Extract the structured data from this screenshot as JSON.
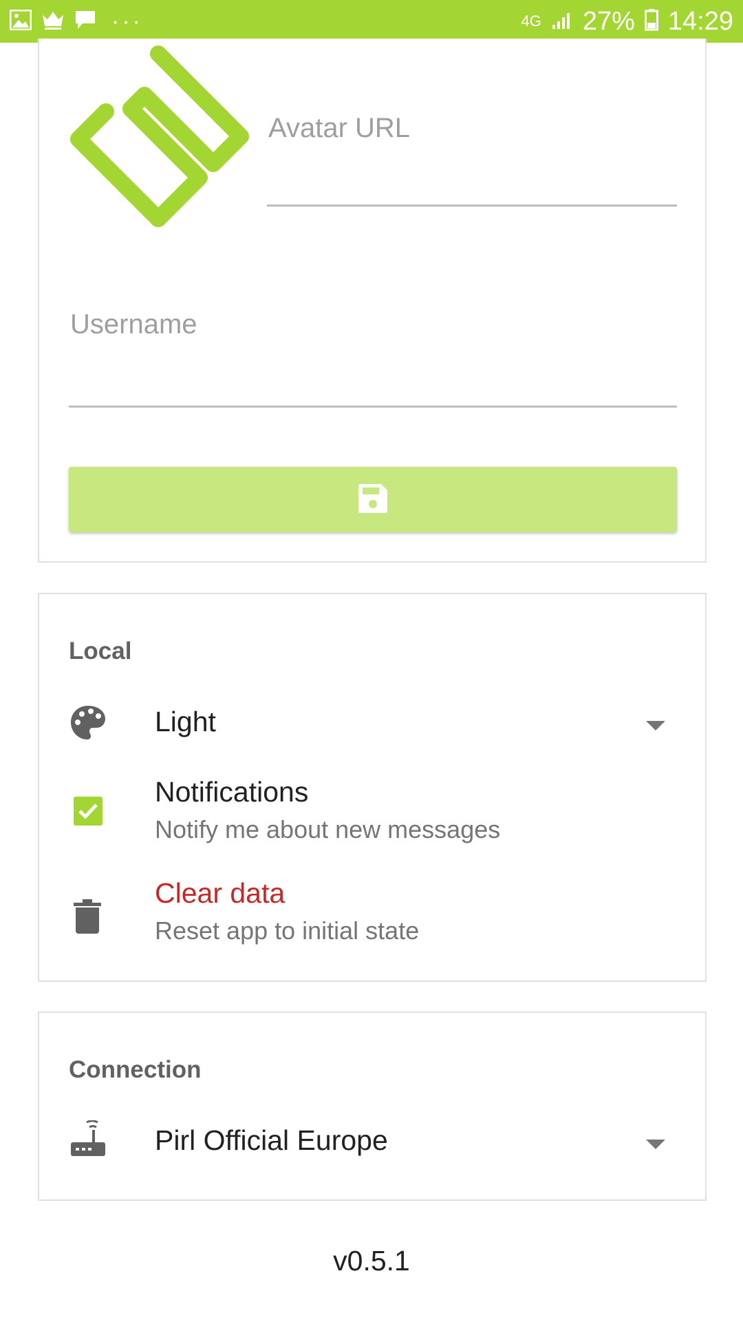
{
  "status_bar": {
    "network": "4G",
    "battery": "27%",
    "time": "14:29",
    "dots": "···"
  },
  "profile": {
    "avatar_label": "Avatar URL",
    "username_label": "Username",
    "save_icon": "save-icon",
    "accent_color": "#a4d633"
  },
  "local": {
    "header": "Local",
    "theme_value": "Light",
    "notifications_title": "Notifications",
    "notifications_subtitle": "Notify me about new messages",
    "notifications_checked": true,
    "clear_title": "Clear data",
    "clear_subtitle": "Reset app to initial state",
    "danger_color": "#c62828"
  },
  "connection": {
    "header": "Connection",
    "server_value": "Pirl Official Europe"
  },
  "version": "v0.5.1"
}
